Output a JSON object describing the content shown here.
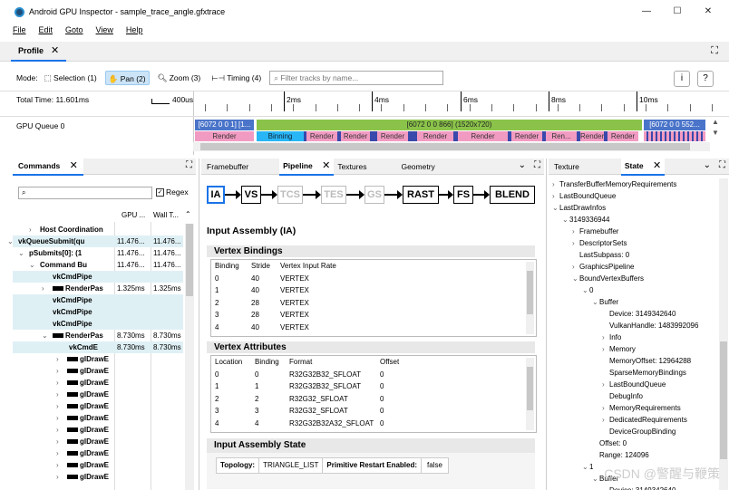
{
  "window": {
    "title": "Android GPU Inspector - sample_trace_angle.gfxtrace",
    "min": "—",
    "max": "☐",
    "close": "✕"
  },
  "menu": [
    "File",
    "Edit",
    "Goto",
    "View",
    "Help"
  ],
  "profile_tab": {
    "label": "Profile",
    "close": "✕"
  },
  "modebar": {
    "mode_label": "Mode:",
    "buttons": [
      "Selection (1)",
      "Pan (2)",
      "Zoom (3)",
      "Timing (4)"
    ],
    "filter_placeholder": "Filter tracks by name...",
    "info": "i",
    "help": "?"
  },
  "timeline": {
    "total_time": "Total Time: 11.601ms",
    "scale_label": "400us",
    "ticks": [
      "2ms",
      "4ms",
      "6ms",
      "8ms",
      "10ms"
    ],
    "track_label": "GPU Queue 0",
    "spans_top": [
      "[6072 0 0 1] [1...",
      "[6072 0 0 866] (1520x720)",
      "[6072 0 0 552..."
    ],
    "spans_bottom": [
      "Render",
      "Binning",
      "Render",
      "Render",
      "Render",
      "Render",
      "Render",
      "Render",
      "Ren...",
      "Render"
    ]
  },
  "commands": {
    "tab": "Commands",
    "search_placeholder": "",
    "regex_label": "Regex",
    "col_gpu": "GPU ...",
    "col_wall": "Wall T...",
    "rows": [
      {
        "name": "Host Coordination",
        "c1": "",
        "c2": ""
      },
      {
        "name": "vkQueueSubmit(qu",
        "c1": "11.476...",
        "c2": "11.476..."
      },
      {
        "name": "pSubmits[0]: (1",
        "c1": "11.476...",
        "c2": "11.476..."
      },
      {
        "name": "Command Bu",
        "c1": "11.476...",
        "c2": "11.476..."
      },
      {
        "name": "vkCmdPipe",
        "c1": "",
        "c2": ""
      },
      {
        "name": "RenderPas",
        "c1": "1.325ms",
        "c2": "1.325ms"
      },
      {
        "name": "vkCmdPipe",
        "c1": "",
        "c2": ""
      },
      {
        "name": "vkCmdPipe",
        "c1": "",
        "c2": ""
      },
      {
        "name": "vkCmdPipe",
        "c1": "",
        "c2": ""
      },
      {
        "name": "RenderPas",
        "c1": "8.730ms",
        "c2": "8.730ms"
      },
      {
        "name": "vkCmdE",
        "c1": "8.730ms",
        "c2": "8.730ms"
      },
      {
        "name": "glDrawE",
        "c1": "",
        "c2": ""
      },
      {
        "name": "glDrawE",
        "c1": "",
        "c2": ""
      },
      {
        "name": "glDrawE",
        "c1": "",
        "c2": ""
      },
      {
        "name": "glDrawE",
        "c1": "",
        "c2": ""
      },
      {
        "name": "glDrawE",
        "c1": "",
        "c2": ""
      },
      {
        "name": "glDrawE",
        "c1": "",
        "c2": ""
      },
      {
        "name": "glDrawE",
        "c1": "",
        "c2": ""
      },
      {
        "name": "glDrawE",
        "c1": "",
        "c2": ""
      },
      {
        "name": "glDrawE",
        "c1": "",
        "c2": ""
      },
      {
        "name": "glDrawE",
        "c1": "",
        "c2": ""
      },
      {
        "name": "glDrawE",
        "c1": "",
        "c2": ""
      }
    ]
  },
  "pipeline": {
    "tabs": [
      "Framebuffer",
      "Pipeline",
      "Textures",
      "Geometry"
    ],
    "stages": [
      "IA",
      "VS",
      "TCS",
      "TES",
      "GS",
      "RAST",
      "FS",
      "BLEND"
    ],
    "title": "Input Assembly (IA)",
    "vertex_bindings": {
      "title": "Vertex Bindings",
      "headers": [
        "Binding",
        "Stride",
        "Vertex Input Rate"
      ],
      "rows": [
        [
          "0",
          "40",
          "VERTEX"
        ],
        [
          "1",
          "40",
          "VERTEX"
        ],
        [
          "2",
          "28",
          "VERTEX"
        ],
        [
          "3",
          "28",
          "VERTEX"
        ],
        [
          "4",
          "40",
          "VERTEX"
        ]
      ]
    },
    "vertex_attributes": {
      "title": "Vertex Attributes",
      "headers": [
        "Location",
        "Binding",
        "Format",
        "Offset"
      ],
      "rows": [
        [
          "0",
          "0",
          "R32G32B32_SFLOAT",
          "0"
        ],
        [
          "1",
          "1",
          "R32G32B32_SFLOAT",
          "0"
        ],
        [
          "2",
          "2",
          "R32G32_SFLOAT",
          "0"
        ],
        [
          "3",
          "3",
          "R32G32_SFLOAT",
          "0"
        ],
        [
          "4",
          "4",
          "R32G32B32A32_SFLOAT",
          "0"
        ]
      ]
    },
    "ia_state": {
      "title": "Input Assembly State",
      "topology_label": "Topology:",
      "topology_value": "TRIANGLE_LIST",
      "restart_label": "Primitive Restart Enabled:",
      "restart_value": "false"
    }
  },
  "state": {
    "tabs": [
      "Texture",
      "State"
    ],
    "rows": [
      {
        "text": "TransferBufferMemoryRequirements",
        "chev": "›",
        "indent": 0
      },
      {
        "text": "LastBoundQueue",
        "chev": "›",
        "indent": 0
      },
      {
        "text": "LastDrawInfos",
        "chev": "⌄",
        "indent": 0
      },
      {
        "text": "3149336944",
        "chev": "⌄",
        "indent": 1
      },
      {
        "text": "Framebuffer",
        "chev": "›",
        "indent": 2
      },
      {
        "text": "DescriptorSets",
        "chev": "›",
        "indent": 2
      },
      {
        "text": "LastSubpass: 0",
        "chev": "",
        "indent": 2
      },
      {
        "text": "GraphicsPipeline",
        "chev": "›",
        "indent": 2
      },
      {
        "text": "BoundVertexBuffers",
        "chev": "⌄",
        "indent": 2
      },
      {
        "text": "0",
        "chev": "⌄",
        "indent": 3
      },
      {
        "text": "Buffer",
        "chev": "⌄",
        "indent": 4
      },
      {
        "text": "Device: 3149342640",
        "chev": "",
        "indent": 5
      },
      {
        "text": "VulkanHandle: 1483992096",
        "chev": "",
        "indent": 5
      },
      {
        "text": "Info",
        "chev": "›",
        "indent": 5
      },
      {
        "text": "Memory",
        "chev": "›",
        "indent": 5
      },
      {
        "text": "MemoryOffset: 12964288",
        "chev": "",
        "indent": 5
      },
      {
        "text": "SparseMemoryBindings",
        "chev": "",
        "indent": 5
      },
      {
        "text": "LastBoundQueue",
        "chev": "›",
        "indent": 5
      },
      {
        "text": "DebugInfo",
        "chev": "",
        "indent": 5
      },
      {
        "text": "MemoryRequirements",
        "chev": "›",
        "indent": 5
      },
      {
        "text": "DedicatedRequirements",
        "chev": "›",
        "indent": 5
      },
      {
        "text": "DeviceGroupBinding",
        "chev": "",
        "indent": 5
      },
      {
        "text": "Offset: 0",
        "chev": "",
        "indent": 4
      },
      {
        "text": "Range: 124096",
        "chev": "",
        "indent": 4
      },
      {
        "text": "1",
        "chev": "⌄",
        "indent": 3
      },
      {
        "text": "Buffer",
        "chev": "⌄",
        "indent": 4
      },
      {
        "text": "Device: 3149342640",
        "chev": "",
        "indent": 5
      }
    ]
  },
  "watermark": "CSDN @警醒与鞭策"
}
